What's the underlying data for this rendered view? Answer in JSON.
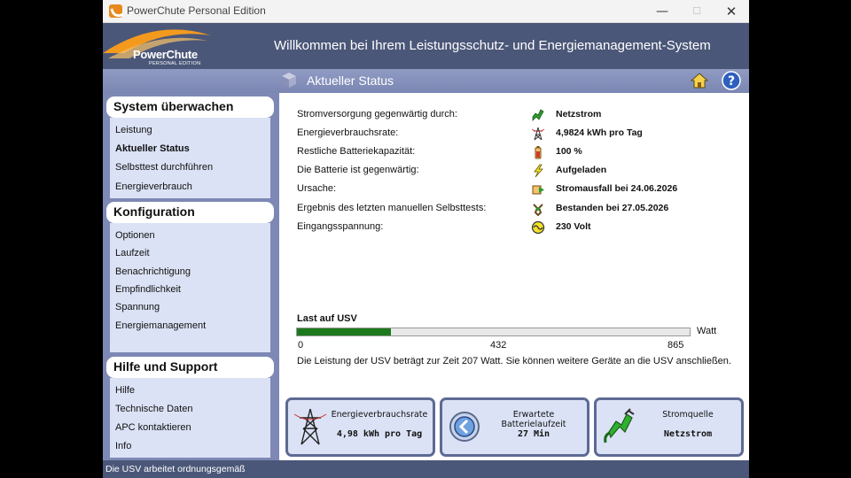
{
  "window": {
    "title": "PowerChute Personal Edition"
  },
  "header": {
    "logo_text": "PowerChute",
    "logo_sub": "PERSONAL EDITION",
    "title": "Willkommen bei Ihrem Leistungsschutz- und Energiemanagement-System"
  },
  "subheader": {
    "title": "Aktueller Status",
    "home_icon": "home-icon",
    "help_icon": "help-icon"
  },
  "sidebar": {
    "sections": [
      {
        "title": "System überwachen",
        "items": [
          "Leistung",
          "Aktueller Status",
          "Selbsttest durchführen",
          "Energieverbrauch"
        ]
      },
      {
        "title": "Konfiguration",
        "items": [
          "Optionen",
          "Laufzeit",
          "Benachrichtigung",
          "Empfindlichkeit",
          "Spannung",
          "Energiemanagement"
        ]
      },
      {
        "title": "Hilfe und Support",
        "items": [
          "Hilfe",
          "Technische Daten",
          "APC kontaktieren",
          "Info"
        ]
      }
    ]
  },
  "status": {
    "rows": [
      {
        "label": "Stromversorgung gegenwärtig durch:",
        "value": "Netzstrom",
        "icon": "power-plug-icon"
      },
      {
        "label": "Energieverbrauchsrate:",
        "value": "4,9824 kWh pro Tag",
        "icon": "power-tower-icon"
      },
      {
        "label": "Restliche Batteriekapazität:",
        "value": "100 %",
        "icon": "battery-icon"
      },
      {
        "label": "Die Batterie ist gegenwärtig:",
        "value": "Aufgeladen",
        "icon": "lightning-icon"
      },
      {
        "label": "Ursache:",
        "value": "Stromausfall bei 24.06.2026",
        "icon": "outage-icon"
      },
      {
        "label": "Ergebnis des letzten manuellen Selbsttests:",
        "value": "Bestanden bei 27.05.2026",
        "icon": "wrench-icon"
      },
      {
        "label": "Eingangsspannung:",
        "value": "230 Volt",
        "icon": "voltage-icon"
      }
    ]
  },
  "load": {
    "title": "Last auf USV",
    "unit": "Watt",
    "current_watts": 207,
    "max_watts": 865,
    "ticks": [
      "0",
      "432",
      "865"
    ],
    "message": "Die Leistung der USV beträgt zur Zeit 207 Watt. Sie können weitere Geräte an die USV anschließen."
  },
  "cards": [
    {
      "title": "Energieverbrauchsrate",
      "value": "4,98 kWh pro Tag",
      "icon": "power-tower-icon"
    },
    {
      "title": "Erwartete Batterielaufzeit",
      "value": "27 Min",
      "icon": "clock-arrow-icon"
    },
    {
      "title": "Stromquelle",
      "value": "Netzstrom",
      "icon": "power-plug-icon"
    }
  ],
  "statusbar": {
    "text": "Die USV arbeitet ordnungsgemäß"
  },
  "colors": {
    "header_bg": "#4b5778",
    "sidebar_bg": "#7d88b5",
    "panel_bg": "#dbe2f5",
    "load_fill": "#1c7a1c"
  }
}
